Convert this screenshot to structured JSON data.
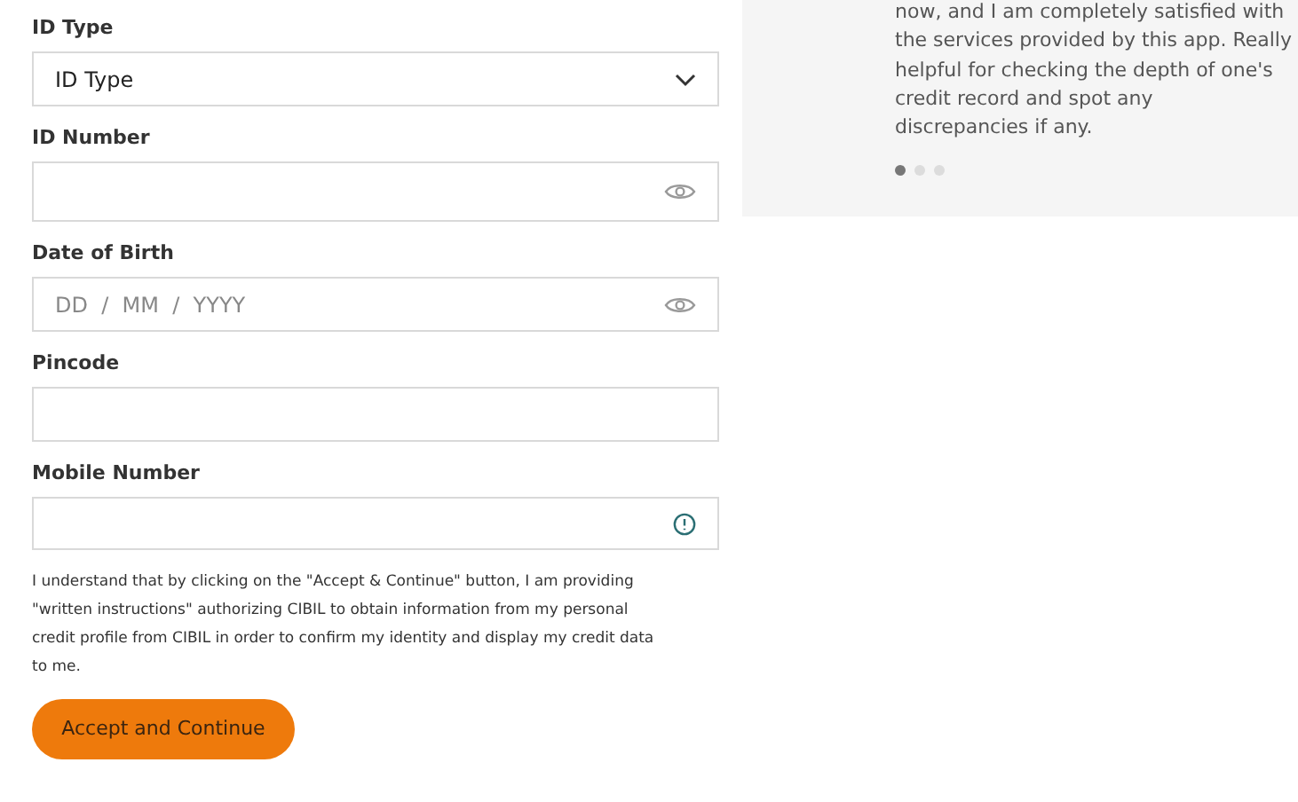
{
  "form": {
    "fields": [
      {
        "kind": "select",
        "label": "ID Type",
        "value": "ID Type"
      },
      {
        "kind": "masked",
        "label": "ID Number"
      },
      {
        "kind": "date",
        "label": "Date of Birth",
        "placeholder": "DD  /  MM  /  YYYY"
      },
      {
        "kind": "text",
        "label": "Pincode"
      },
      {
        "kind": "info",
        "label": "Mobile Number"
      }
    ],
    "consent_lines": [
      "I understand that by clicking on the \"Accept & Continue\" button, I am providing",
      "\"written instructions\" authorizing CIBIL to obtain information from my personal",
      "credit profile from CIBIL in order to confirm my identity and display my credit data",
      "to me."
    ],
    "submit_button": "Accept and Continue"
  },
  "testimonial": {
    "lines": [
      "now, and I am completely satisfied with",
      "the services provided by this app. Really",
      "helpful for checking the depth of one's",
      "credit record and spot any",
      "discrepancies if any."
    ],
    "dots": [
      {
        "selected": true
      },
      {
        "selected": false
      },
      {
        "selected": false
      }
    ]
  }
}
